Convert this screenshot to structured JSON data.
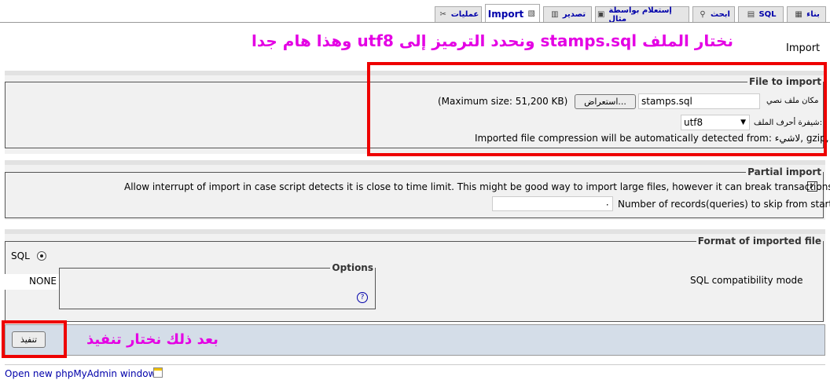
{
  "tabs": [
    {
      "label": "بناء",
      "icon": "structure-icon"
    },
    {
      "label": "SQL",
      "icon": "sql-icon"
    },
    {
      "label": "ابحث",
      "icon": "search-icon"
    },
    {
      "label": "إستعلام بواسطة مثال",
      "icon": "query-icon"
    },
    {
      "label": "تصدير",
      "icon": "export-icon"
    },
    {
      "label": "Import",
      "icon": "import-icon"
    },
    {
      "label": "عمليات",
      "icon": "operations-icon"
    }
  ],
  "annotations": {
    "top": "نختار الملف stamps.sql ونحدد الترميز إلى utf8 وهذا هام جدا",
    "bottom": "بعد ذلك نختار تنفيذ"
  },
  "page_title": "Import",
  "file_to_import": {
    "legend": "File to import",
    "file_label": "مكان ملف نصي",
    "file_value": "stamps.sql",
    "browse_button": "استعراض...",
    "max_size": "(Maximum size: 51,200 KB)",
    "charset_label": "شيفرة أحرف الملف:",
    "charset_value": "utf8",
    "compression_note": "Imported file compression will be automatically detected from: لاشيء, gzip, zip"
  },
  "partial_import": {
    "legend": "Partial import",
    "allow_interrupt": "Allow interrupt of import in case script detects it is close to time limit. This might be good way to import large files, however it can break transactions.",
    "skip_label": "Number of records(queries) to skip from start",
    "skip_value": "٠"
  },
  "format": {
    "legend": "Format of imported file",
    "sql_label": "SQL",
    "options_legend": "Options",
    "compat_label": "SQL compatibility mode",
    "compat_value": "NONE",
    "help_icon_char": "?"
  },
  "go_button": "تنفيذ",
  "footer_link": "Open new phpMyAdmin window"
}
